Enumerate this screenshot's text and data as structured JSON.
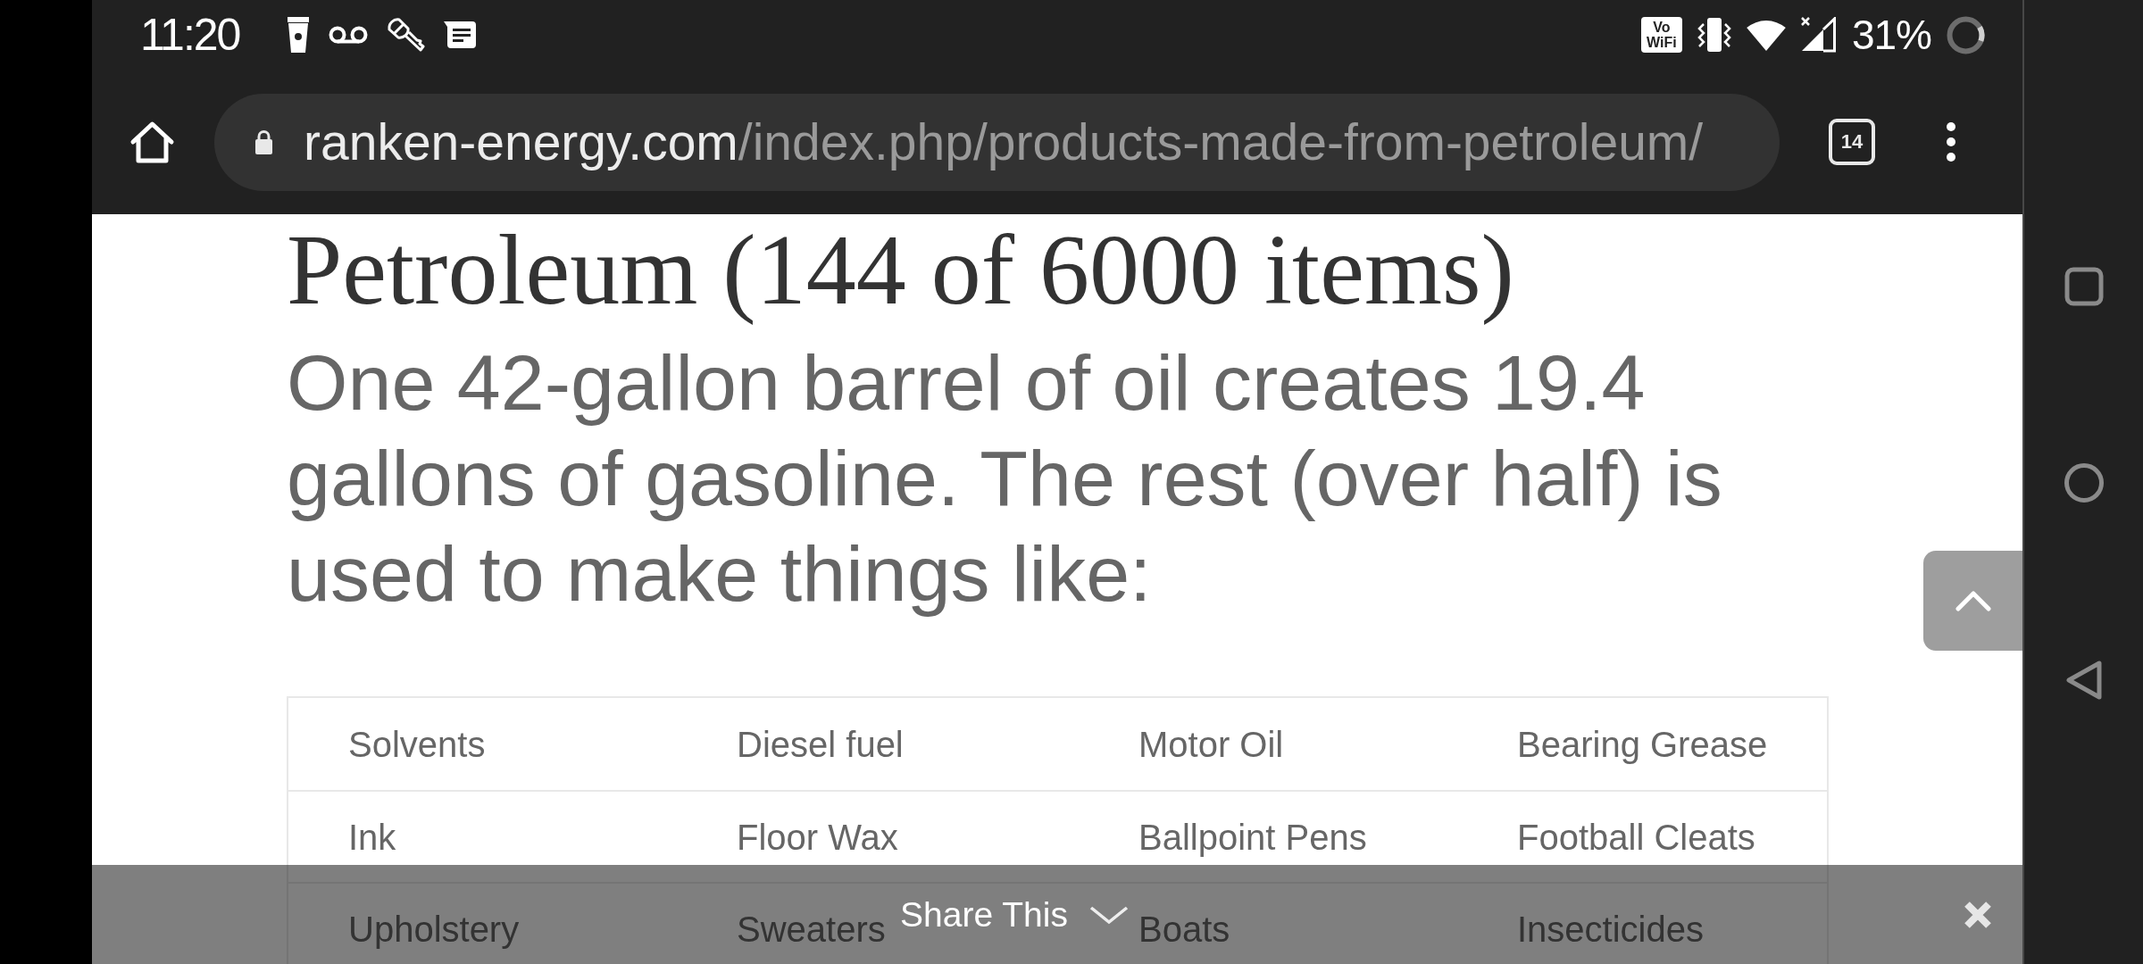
{
  "status_bar": {
    "time": "11:20",
    "wifi_calling_badge": [
      "Vo",
      "WiFi"
    ],
    "battery_percent": "31%"
  },
  "browser_toolbar": {
    "url_host": "ranken-energy.com",
    "url_path": "/index.php/products-made-from-petroleum/",
    "tab_count": "14"
  },
  "page": {
    "heading": "Petroleum (144 of 6000 items)",
    "intro": "One 42-gallon barrel of oil creates 19.4 gallons of gasoline. The rest (over half) is used to make things like:",
    "table": {
      "rows": [
        [
          "Solvents",
          "Diesel fuel",
          "Motor Oil",
          "Bearing Grease"
        ],
        [
          "Ink",
          "Floor Wax",
          "Ballpoint Pens",
          "Football Cleats"
        ],
        [
          "Upholstery",
          "Sweaters",
          "Boats",
          "Insecticides"
        ]
      ]
    }
  },
  "share_bar": {
    "label": "Share This"
  }
}
